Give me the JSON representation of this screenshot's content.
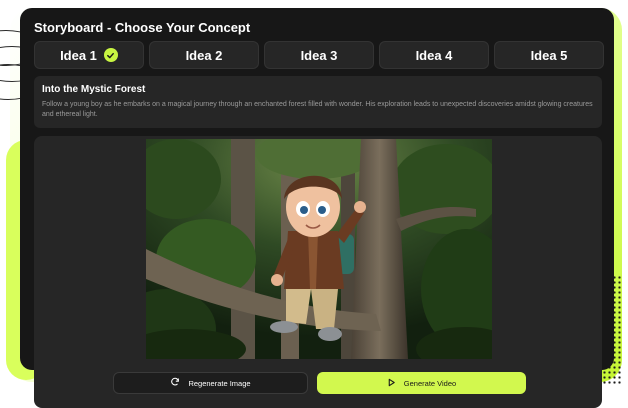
{
  "window": {
    "title": "Storyboard - Choose Your Concept"
  },
  "tabs": [
    {
      "label": "Idea 1",
      "selected": true
    },
    {
      "label": "Idea 2",
      "selected": false
    },
    {
      "label": "Idea 3",
      "selected": false
    },
    {
      "label": "Idea 4",
      "selected": false
    },
    {
      "label": "Idea 5",
      "selected": false
    }
  ],
  "concept": {
    "title": "Into the Mystic Forest",
    "description": "Follow a young boy as he embarks on a magical journey through an enchanted forest filled with wonder. His exploration leads to unexpected discoveries amidst glowing creatures and ethereal light."
  },
  "preview": {
    "icon": "forest-boy-illustration"
  },
  "actions": {
    "regenerate_label": "Regenerate Image",
    "regenerate_icon": "refresh-icon",
    "generate_label": "Generate Video",
    "generate_icon": "play-icon"
  },
  "colors": {
    "accent": "#d2f84e",
    "window_bg": "#171717",
    "panel_bg": "#262626"
  }
}
